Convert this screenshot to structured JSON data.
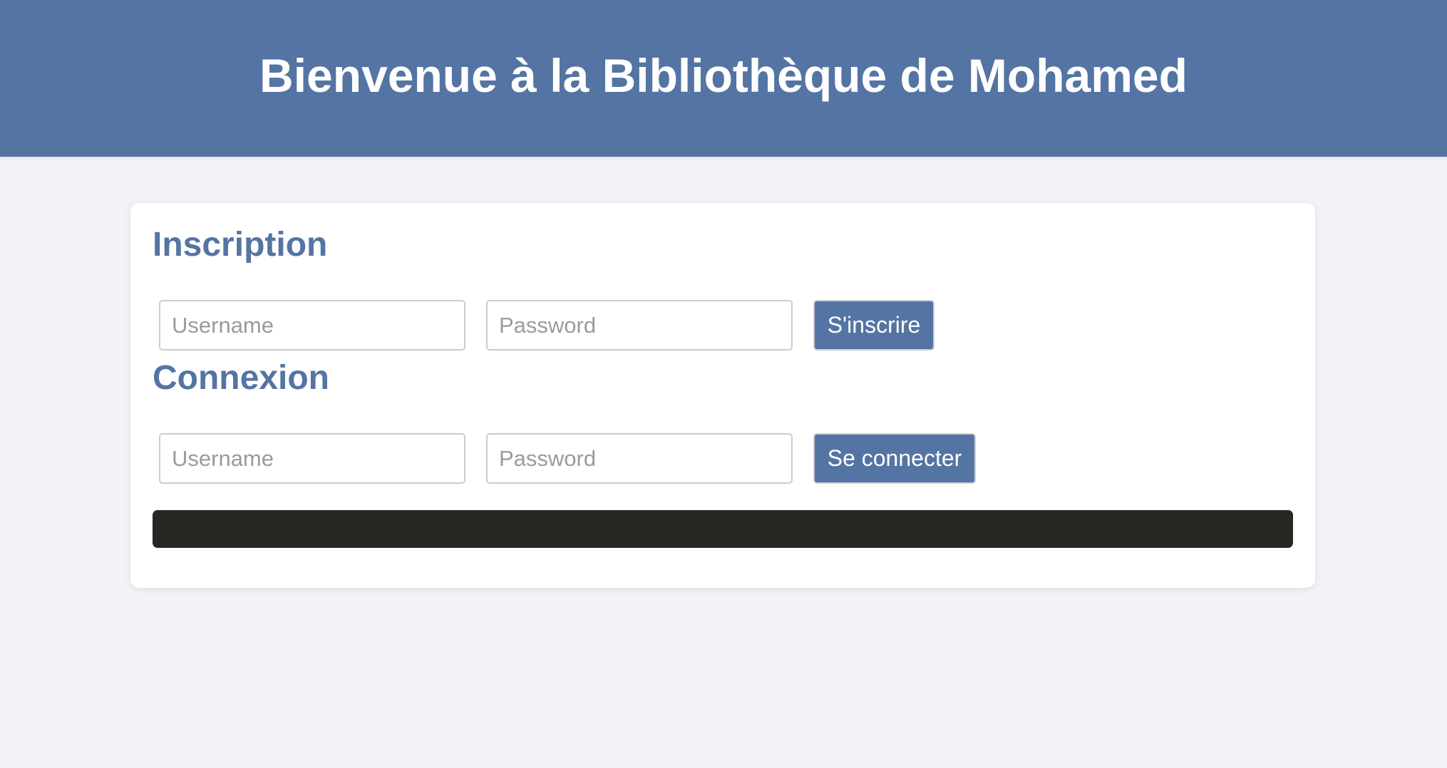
{
  "header": {
    "title": "Bienvenue à la Bibliothèque de Mohamed"
  },
  "register": {
    "title": "Inscription",
    "username_placeholder": "Username",
    "username_value": "",
    "password_placeholder": "Password",
    "password_value": "",
    "submit_label": "S'inscrire"
  },
  "login": {
    "title": "Connexion",
    "username_placeholder": "Username",
    "username_value": "",
    "password_placeholder": "Password",
    "password_value": "",
    "submit_label": "Se connecter"
  },
  "message": {
    "text": ""
  },
  "colors": {
    "accent": "#5474a3",
    "background": "#f3f3f7",
    "message_bar": "#272723"
  }
}
